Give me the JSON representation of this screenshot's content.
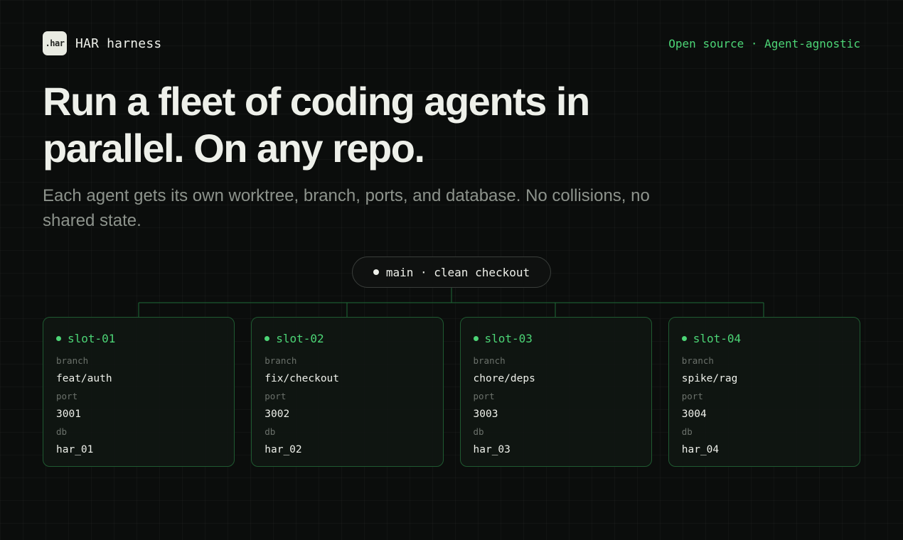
{
  "header": {
    "logo_text": ".har",
    "brand_name": "HAR harness",
    "tagline": "Open source · Agent-agnostic"
  },
  "hero": {
    "title": "Run a fleet of coding agents in parallel. On any repo.",
    "subtitle": "Each agent gets its own worktree, branch, ports, and database. No collisions, no shared state."
  },
  "main_node": {
    "label": "main · clean checkout"
  },
  "field_labels": {
    "branch": "branch",
    "port": "port",
    "db": "db"
  },
  "slots": [
    {
      "name": "slot-01",
      "branch": "feat/auth",
      "port": "3001",
      "db": "har_01"
    },
    {
      "name": "slot-02",
      "branch": "fix/checkout",
      "port": "3002",
      "db": "har_02"
    },
    {
      "name": "slot-03",
      "branch": "chore/deps",
      "port": "3003",
      "db": "har_03"
    },
    {
      "name": "slot-04",
      "branch": "spike/rag",
      "port": "3004",
      "db": "har_04"
    }
  ],
  "colors": {
    "accent": "#4cd576",
    "background": "#0b0d0c",
    "card_border": "#1f5a31",
    "connector": "#1f6b37"
  }
}
